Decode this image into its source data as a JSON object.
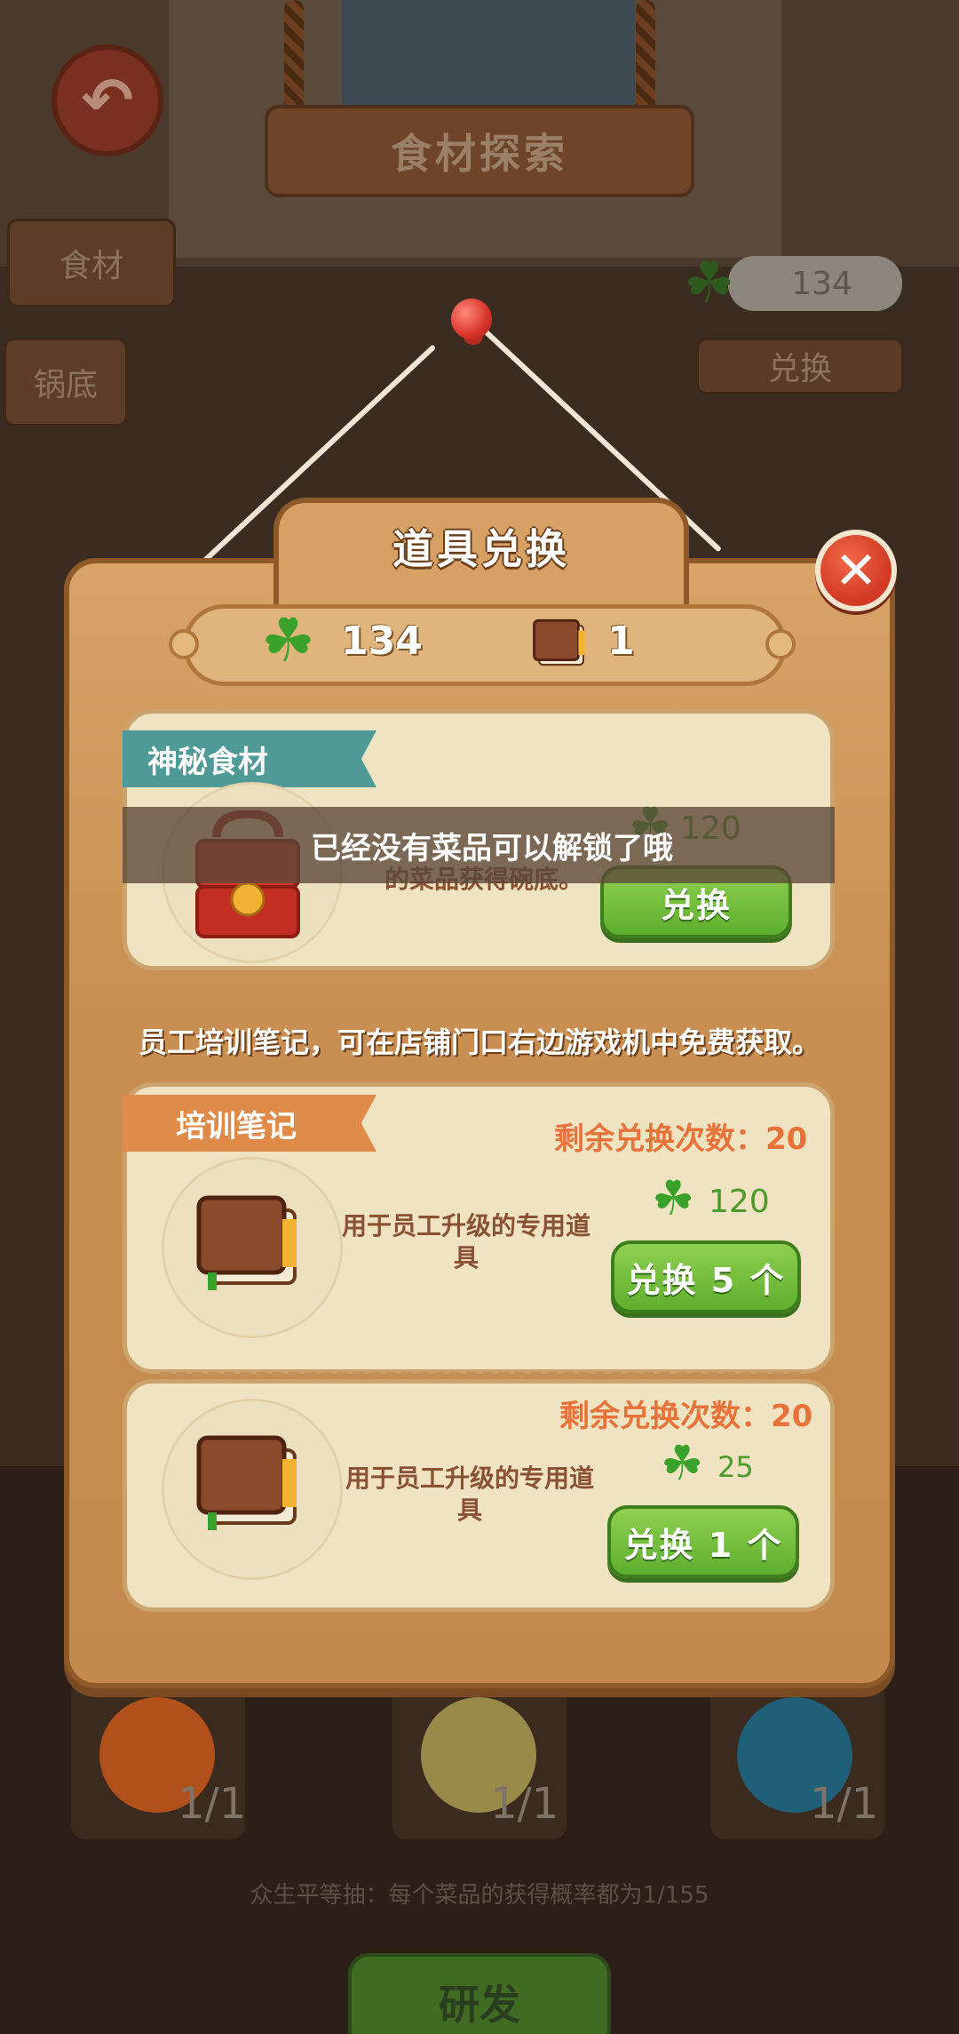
{
  "background": {
    "title": "食材探索",
    "tabs": [
      "食材",
      "锅底"
    ],
    "clover_count": "134",
    "exchange_label": "兑换",
    "slots": [
      {
        "count": "1/1",
        "color": "#d86a1c"
      },
      {
        "count": "1/1",
        "color": "#e8d27a"
      },
      {
        "count": "1/1",
        "color": "#2b9cc4"
      }
    ],
    "hint": "众生平等抽：每个菜品的获得概率都为1/155",
    "research_label": "研发"
  },
  "modal": {
    "title": "道具兑换",
    "currency": {
      "clovers": "134",
      "notes": "1"
    },
    "mystery": {
      "ribbon": "神秘食材",
      "price": "120",
      "desc_partial": "的菜品获得碗底。",
      "button": "兑换"
    },
    "toast": "已经没有菜品可以解锁了哦",
    "info": "员工培训笔记，可在店铺门口右边游戏机中免费获取。",
    "training": {
      "ribbon": "培训笔记",
      "items": [
        {
          "remaining": "剩余兑换次数：20",
          "desc": "用于员工升级的专用道具",
          "price": "120",
          "button": "兑换 5 个"
        },
        {
          "remaining": "剩余兑换次数：20",
          "desc": "用于员工升级的专用道具",
          "price": "25",
          "button": "兑换 1 个"
        }
      ]
    }
  },
  "colors": {
    "accent_green": "#5fae2e",
    "remain_orange": "#e8733a",
    "wood": "#c98f52"
  }
}
